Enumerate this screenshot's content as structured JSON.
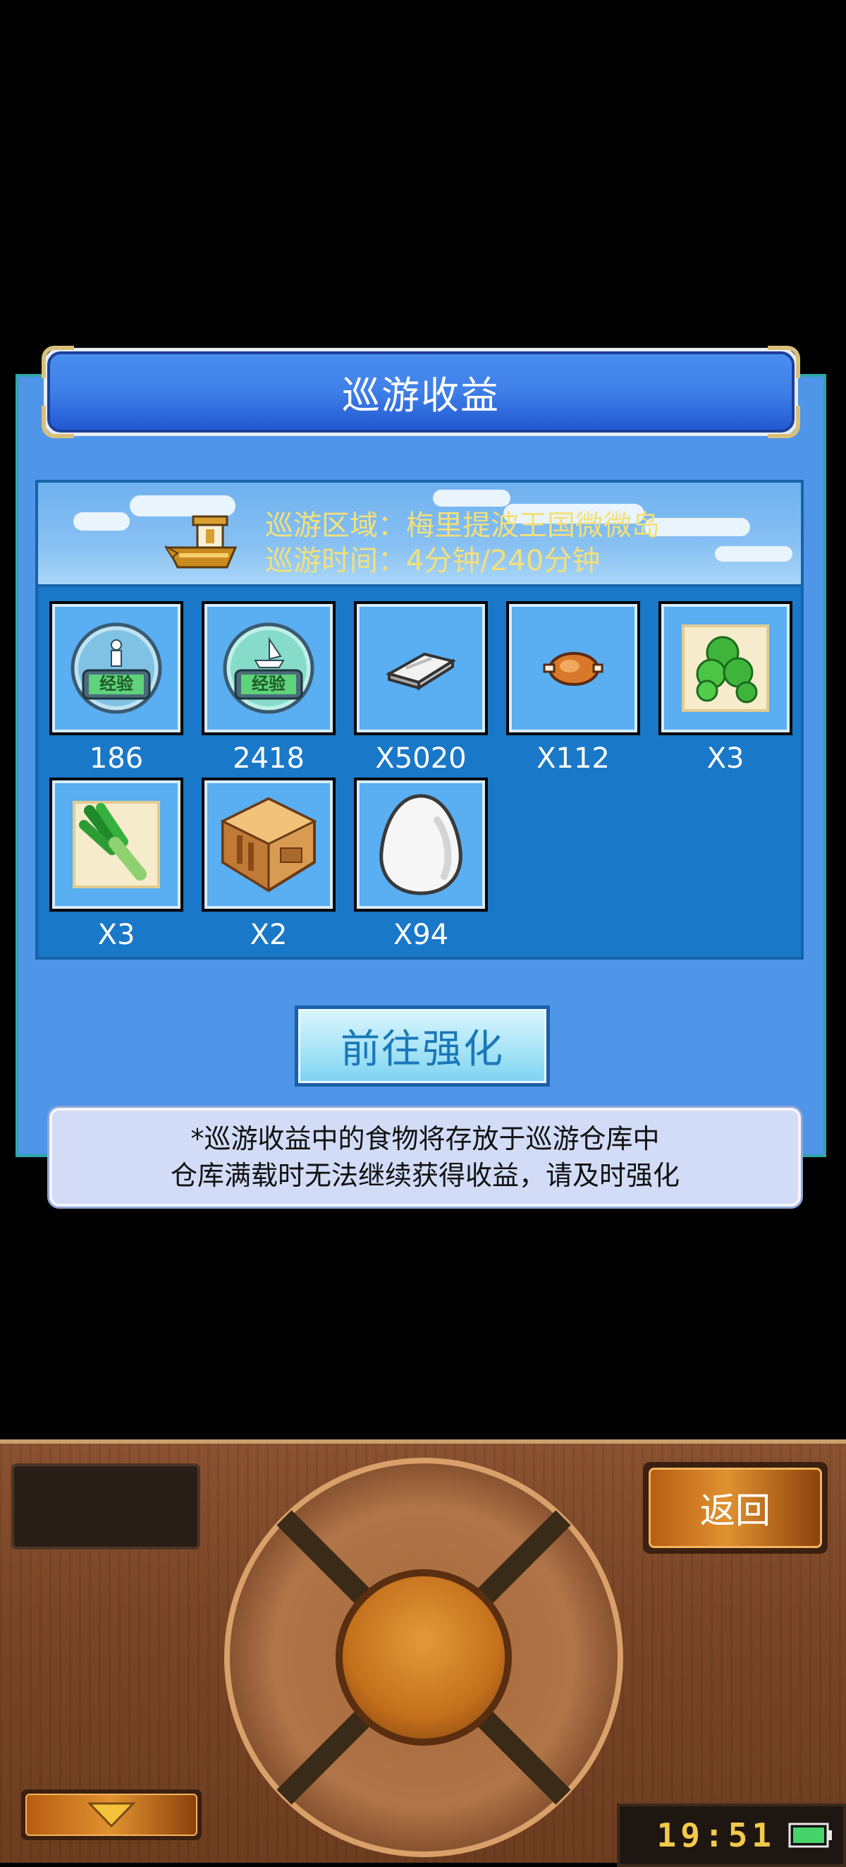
{
  "dialog": {
    "title": "巡游收益",
    "info": {
      "area": "巡游区域：梅里提波王国微微岛",
      "time": "巡游时间：4分钟/240分钟"
    },
    "rewards": [
      {
        "icon": "exp-person-icon",
        "count": "186"
      },
      {
        "icon": "exp-ship-icon",
        "count": "2418"
      },
      {
        "icon": "silver-bar-icon",
        "count": "X5020"
      },
      {
        "icon": "roast-meat-icon",
        "count": "X112"
      },
      {
        "icon": "green-peas-icon",
        "count": "X3"
      },
      {
        "icon": "green-leek-icon",
        "count": "X3"
      },
      {
        "icon": "wooden-room-icon",
        "count": "X2"
      },
      {
        "icon": "egg-icon",
        "count": "X94"
      }
    ],
    "enhance_button": "前往强化",
    "notice": {
      "line1": "*巡游收益中的食物将存放于巡游仓库中",
      "line2": "仓库满载时无法继续获得收益，请及时强化"
    }
  },
  "device": {
    "back_button": "返回",
    "clock": "19:51",
    "colors": {
      "wood": "#7a4626",
      "button_orange": "#e09230",
      "clock_text": "#f3c94a",
      "battery": "#46d36a"
    }
  },
  "colors": {
    "dialog_bg": "#4f95e8",
    "panel_bg": "#1a78c8",
    "title_bg": "#3f7fe8",
    "info_text": "#f3e07a"
  }
}
